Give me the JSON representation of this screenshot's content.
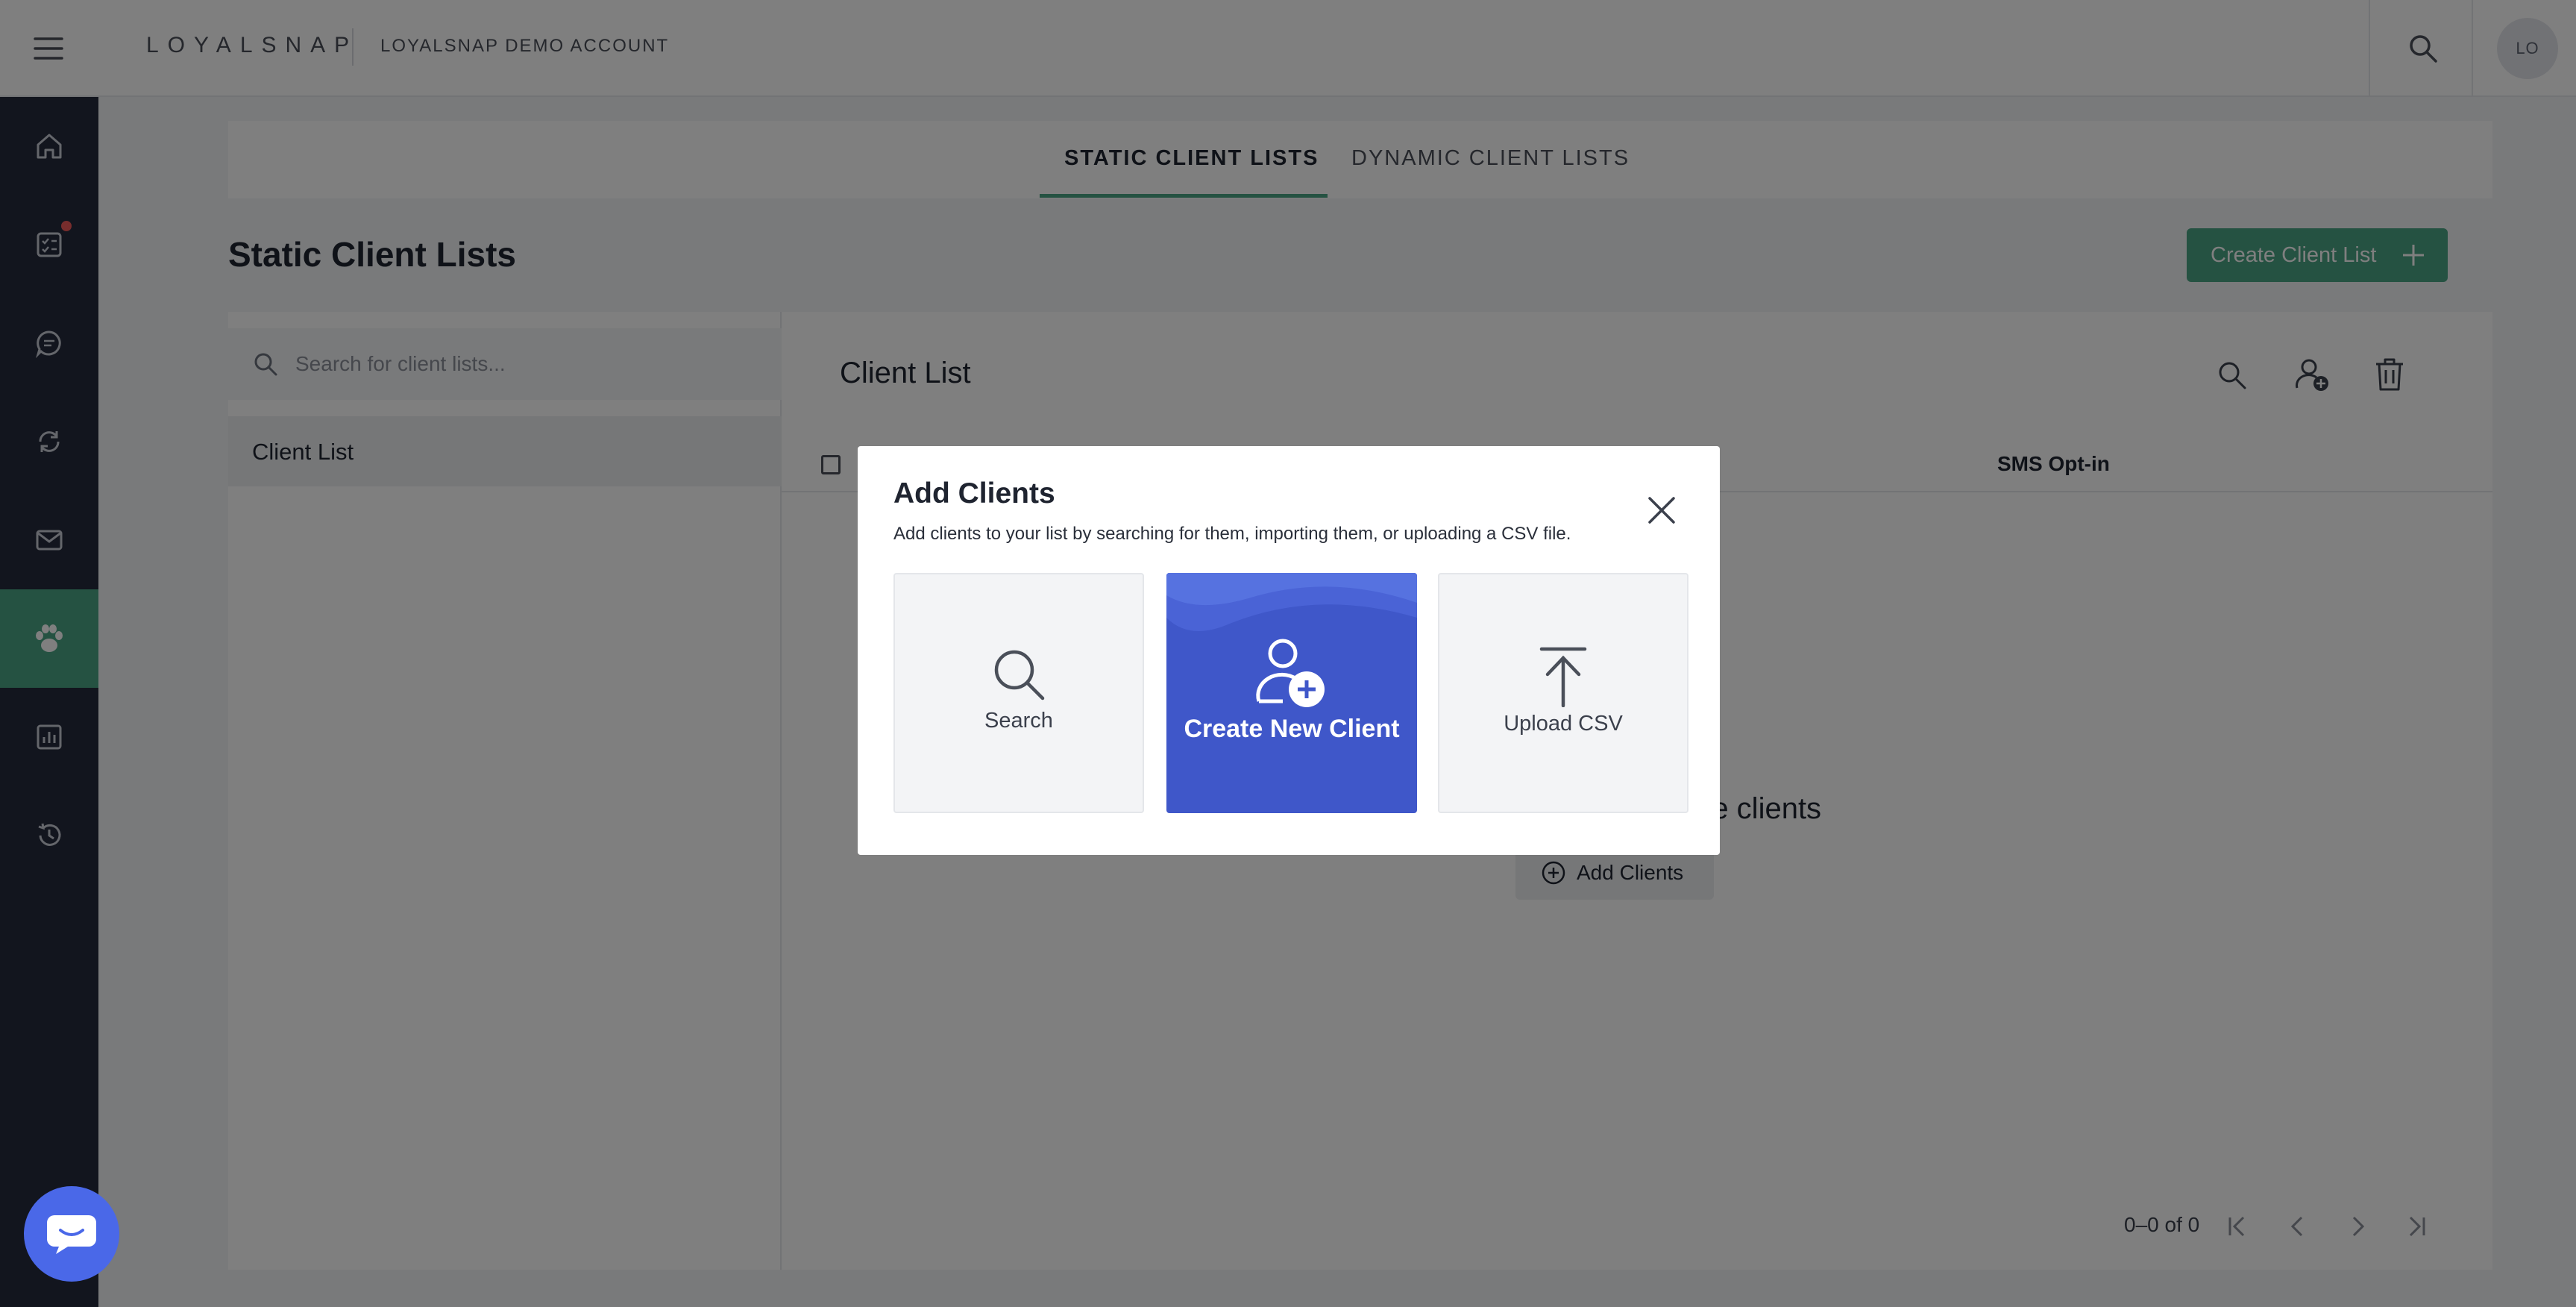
{
  "header": {
    "logo": "LOYALSNAP",
    "account_name": "LOYALSNAP DEMO ACCOUNT",
    "avatar_initials": "LO"
  },
  "sidebar": {
    "items": [
      {
        "icon": "home-icon"
      },
      {
        "icon": "checklist-icon",
        "notification": true
      },
      {
        "icon": "chat-icon"
      },
      {
        "icon": "sync-icon"
      },
      {
        "icon": "mail-icon"
      },
      {
        "icon": "paw-icon",
        "active": true
      },
      {
        "icon": "chart-icon"
      },
      {
        "icon": "history-icon"
      }
    ]
  },
  "tabs": [
    {
      "label": "STATIC CLIENT LISTS",
      "active": true
    },
    {
      "label": "DYNAMIC CLIENT LISTS",
      "active": false
    }
  ],
  "page": {
    "title": "Static Client Lists",
    "create_button": "Create Client List"
  },
  "left_panel": {
    "search_placeholder": "Search for client lists...",
    "items": [
      "Client List"
    ]
  },
  "right_panel": {
    "title": "Client List",
    "column_header": "SMS Opt-in",
    "empty_text": "me clients",
    "add_button": "Add Clients",
    "pagination": "0–0 of 0"
  },
  "modal": {
    "title": "Add Clients",
    "subtitle": "Add clients to your list by searching for them, importing them, or uploading a CSV file.",
    "cards": [
      {
        "label": "Search",
        "icon": "search-icon"
      },
      {
        "label": "Create New Client",
        "icon": "add-user-icon"
      },
      {
        "label": "Upload CSV",
        "icon": "upload-icon"
      }
    ]
  },
  "colors": {
    "accent": "#4aa584",
    "sidebar": "#252a3d",
    "primary_card": "#3f57c9",
    "chat_button": "#4a68e8"
  }
}
